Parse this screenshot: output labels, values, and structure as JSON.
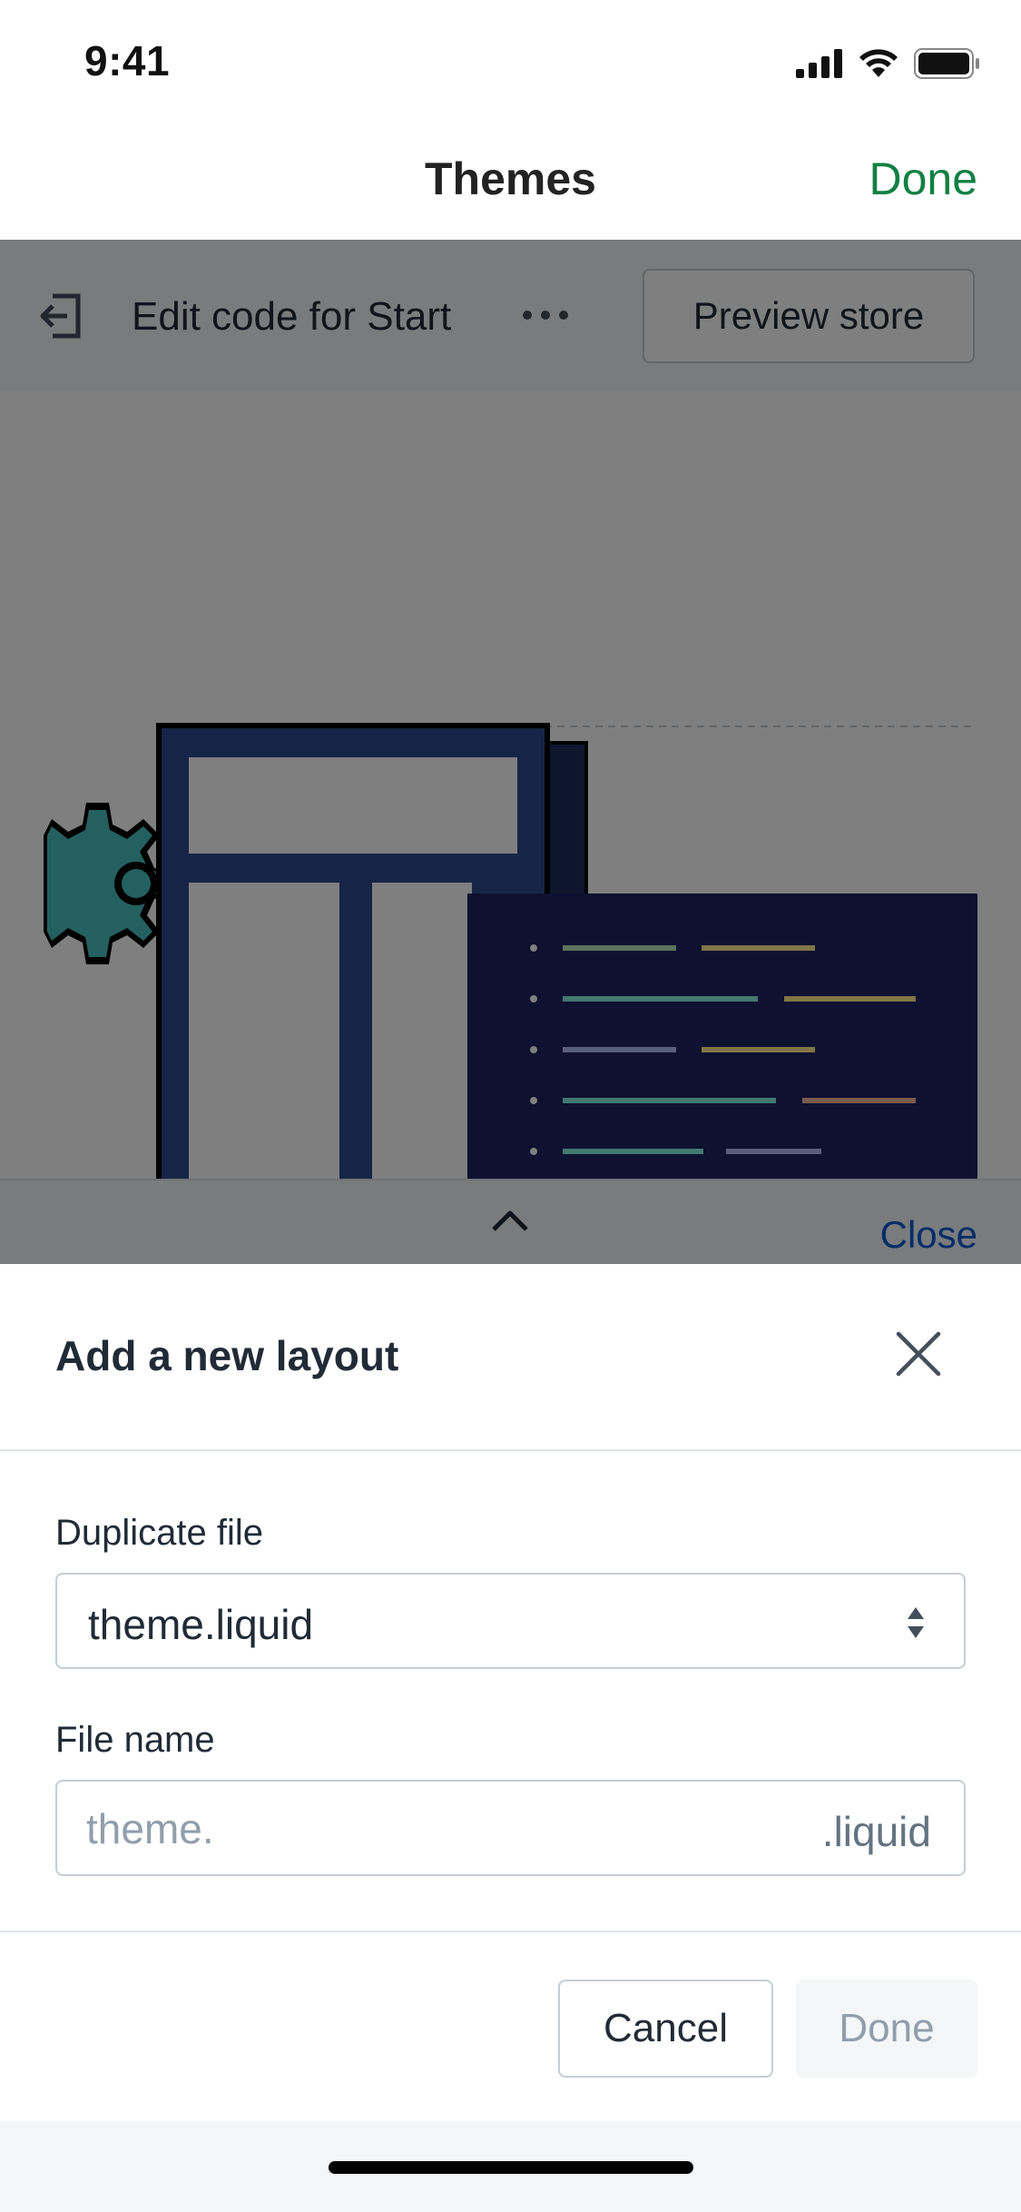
{
  "status_bar": {
    "time": "9:41",
    "icons": [
      "signal-icon",
      "wifi-icon",
      "battery-icon"
    ]
  },
  "nav": {
    "title": "Themes",
    "done_label": "Done",
    "done_color": "#108043"
  },
  "editor": {
    "title": "Edit code for Start",
    "more_icon": "more-horizontal-icon",
    "exit_icon": "exit-icon",
    "preview_label": "Preview store",
    "close_label": "Close",
    "chevron_icon": "chevron-up-icon"
  },
  "sheet": {
    "title": "Add a new layout",
    "close_icon": "close-icon",
    "duplicate": {
      "label": "Duplicate file",
      "value": "theme.liquid"
    },
    "file_name": {
      "label": "File name",
      "placeholder": "theme.",
      "value": "",
      "suffix": ".liquid"
    },
    "cancel_label": "Cancel",
    "done_label": "Done"
  }
}
